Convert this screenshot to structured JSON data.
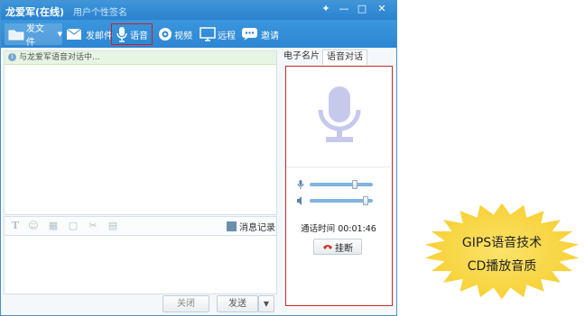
{
  "window": {
    "title": "龙爱军(在线)",
    "signature": "用户个性签名"
  },
  "titlebar_buttons": [
    "pin-icon",
    "minimize-icon",
    "maximize-icon",
    "close-icon"
  ],
  "toolbar": {
    "send_file": "发文件",
    "send_mail": "发邮件",
    "voice": "语音",
    "video": "视频",
    "remote": "远程",
    "invite": "邀请"
  },
  "chat": {
    "notice": "与龙爱军语音对话中..."
  },
  "edit_toolbar": {
    "icons": [
      "font-icon",
      "emoji-icon",
      "image-icon",
      "screenshot-icon",
      "scissors-icon",
      "file-icon"
    ],
    "history": "消息记录"
  },
  "buttons": {
    "close": "关闭",
    "send": "发送",
    "send_arrow": "▼"
  },
  "tabs": [
    {
      "label": "电子名片",
      "active": false
    },
    {
      "label": "语音对话",
      "active": true
    }
  ],
  "voice_panel": {
    "mic_volume": 0.75,
    "speaker_volume": 0.95,
    "call_time_label": "通话时间",
    "call_time": "00:01:46",
    "hangup": "挂断"
  },
  "badge": {
    "line1": "GIPS语音技术",
    "line2": "CD播放音质"
  },
  "colors": {
    "titlebar": "#2b82cd",
    "highlight_border": "#d21f1f",
    "mic": "#c7c9ec",
    "badge": "#f9dd4a"
  }
}
